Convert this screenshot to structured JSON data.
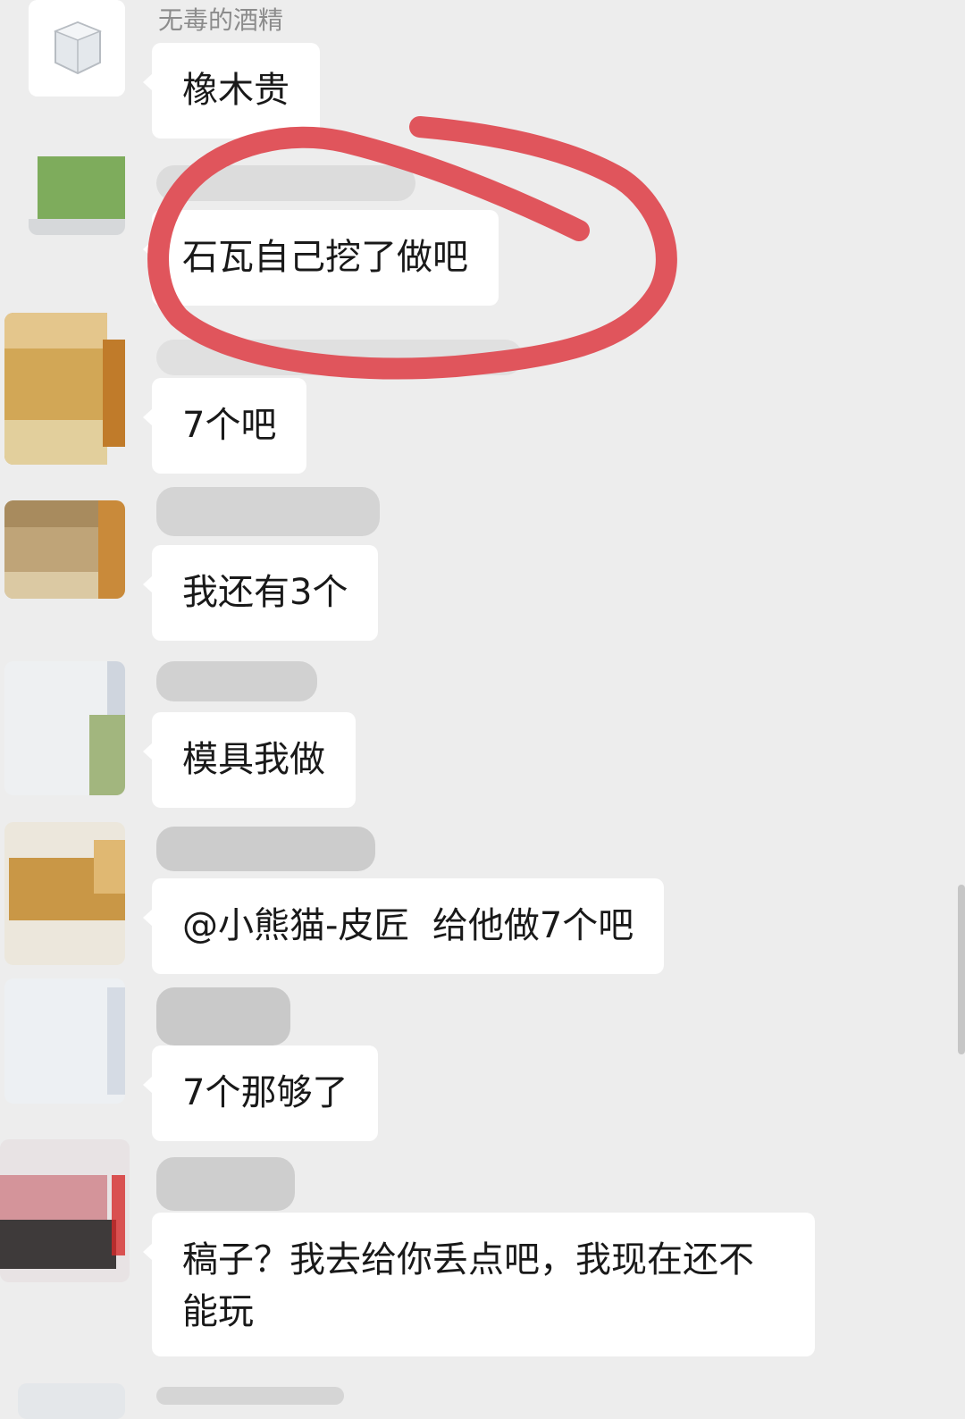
{
  "messages": [
    {
      "sender": "无毒的酒精",
      "text": "橡木贵"
    },
    {
      "sender": "",
      "text": "石瓦自己挖了做吧"
    },
    {
      "sender": "",
      "text": "7个吧"
    },
    {
      "sender": "",
      "text": "我还有3个"
    },
    {
      "sender": "",
      "text": "模具我做"
    },
    {
      "sender": "",
      "text": "@小熊猫-皮匠  给他做7个吧"
    },
    {
      "sender": "",
      "text": "7个那够了"
    },
    {
      "sender": "",
      "text": "稿子？我去给你丢点吧，我现在还不能玩"
    }
  ],
  "annotation": {
    "color": "#e0555c"
  }
}
